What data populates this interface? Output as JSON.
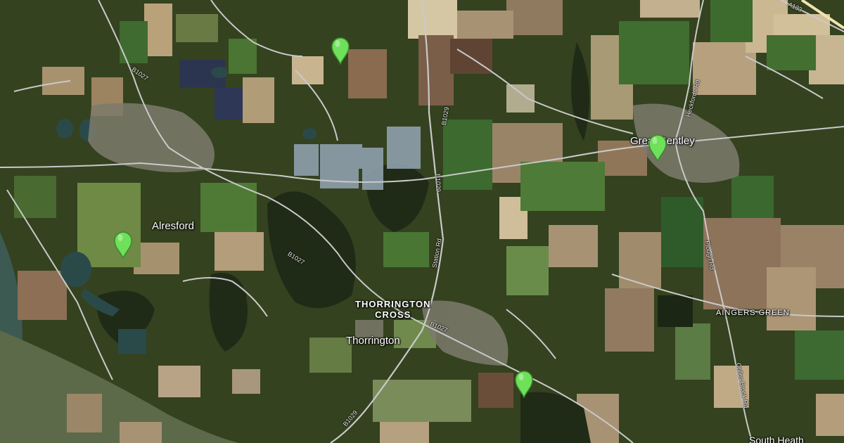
{
  "map": {
    "labels": {
      "alresford": "Alresford",
      "thorrington_cross_line1": "THORRINGTON",
      "thorrington_cross_line2": "CROSS",
      "thorrington": "Thorrington",
      "great_bentley": "Great Bentley",
      "aingers_green": "AINGERS GREEN",
      "south_heath": "South Heath"
    },
    "roads": {
      "b1027_north": "B1027",
      "b1027_mid": "B1027",
      "b1027_east": "B1027",
      "b1029_north": "B1029",
      "b1029_south": "B1029",
      "station_rd": "Station Rd",
      "plough_rd": "Plough Rd",
      "heckfords_rd": "Heckfords Rd",
      "colles_brook_rd": "Colles Brook Rd",
      "a133": "A133"
    },
    "markers": [
      {
        "name": "marker-1",
        "color": "#66dd55"
      },
      {
        "name": "marker-2",
        "color": "#66dd55"
      },
      {
        "name": "marker-3",
        "color": "#66dd55"
      },
      {
        "name": "marker-4",
        "color": "#66dd55"
      }
    ],
    "colors": {
      "pin_fill": "#6fe05a",
      "pin_stroke": "#3a8a2e",
      "road": "#c9c9c9"
    }
  }
}
